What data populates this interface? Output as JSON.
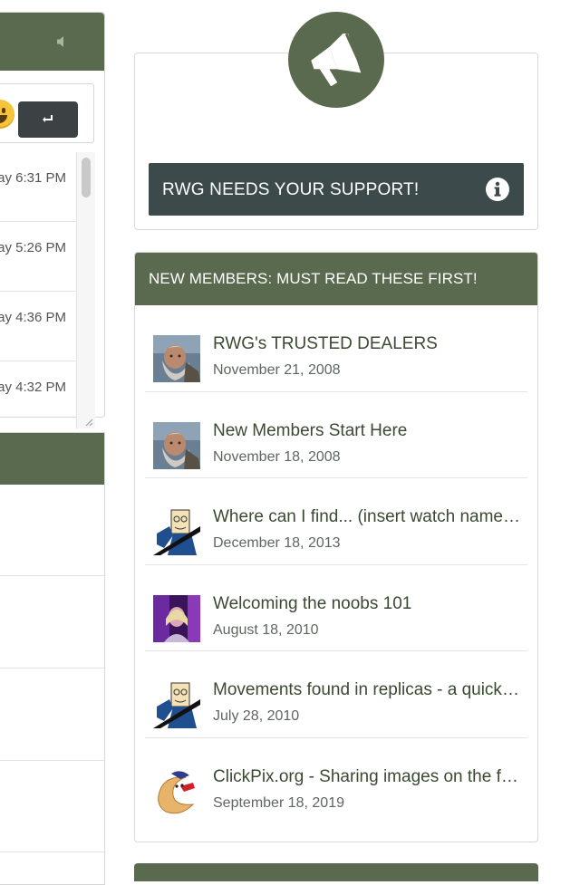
{
  "chat": {
    "times": [
      "ay 6:31 PM",
      "ay 5:26 PM",
      "ay 4:36 PM",
      "ay 4:32 PM"
    ]
  },
  "support": {
    "button_label": "RWG NEEDS YOUR SUPPORT!"
  },
  "members": {
    "title": "NEW MEMBERS: MUST READ THESE FIRST!",
    "topics": [
      {
        "title": "RWG's TRUSTED DEALERS",
        "date": "November 21, 2008",
        "avatar": "bearded-man-avatar"
      },
      {
        "title": "New Members Start Here",
        "date": "November 18, 2008",
        "avatar": "bearded-man-avatar"
      },
      {
        "title": "Where can I find... (insert watch name here)",
        "date": "December 18, 2013",
        "avatar": "cartoon-face-avatar"
      },
      {
        "title": "Welcoming the noobs 101",
        "date": "August 18, 2010",
        "avatar": "purple-photo-avatar"
      },
      {
        "title": "Movements found in replicas - a quick guide",
        "date": "July 28, 2010",
        "avatar": "cartoon-face-avatar"
      },
      {
        "title": "ClickPix.org - Sharing images on the forum",
        "date": "September 18, 2019",
        "avatar": "croissant-mascot-avatar"
      }
    ]
  },
  "colors": {
    "header_green": "#5a6a4e",
    "support_button": "#3c4a4c",
    "send_button": "#3c4244"
  }
}
